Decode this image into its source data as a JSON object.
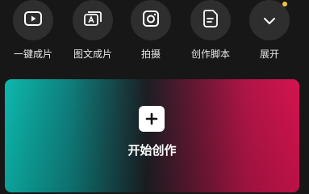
{
  "tools": [
    {
      "label": "一键成片",
      "icon": "play-square-icon"
    },
    {
      "label": "图文成片",
      "icon": "image-text-icon"
    },
    {
      "label": "拍摄",
      "icon": "camera-icon"
    },
    {
      "label": "创作脚本",
      "icon": "script-document-icon"
    },
    {
      "label": "展开",
      "icon": "chevron-down-icon",
      "badge_color": "#f5c542"
    }
  ],
  "create": {
    "label": "开始创作",
    "icon": "plus-icon",
    "gradient_start": "#0db8ae",
    "gradient_end": "#d4134f"
  },
  "colors": {
    "background": "#171717",
    "tool_circle": "#2e2e2e",
    "text": "#e8e8e8"
  }
}
